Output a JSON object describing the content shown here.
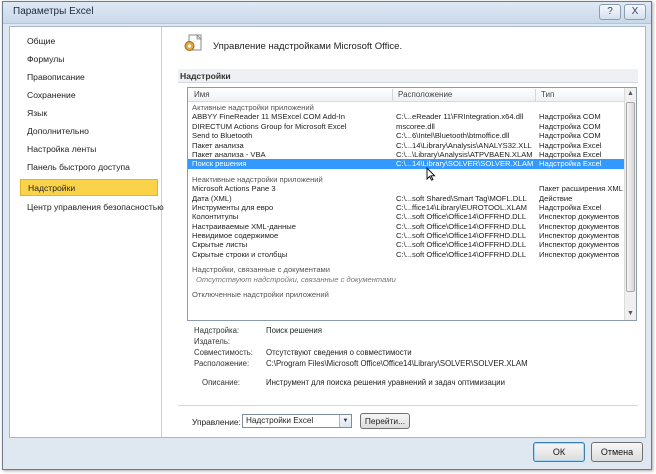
{
  "window": {
    "title": "Параметры Excel",
    "help_glyph": "?",
    "close_glyph": "X"
  },
  "nav": {
    "items": [
      {
        "label": "Общие"
      },
      {
        "label": "Формулы"
      },
      {
        "label": "Правописание"
      },
      {
        "label": "Сохранение"
      },
      {
        "label": "Язык"
      },
      {
        "label": "Дополнительно"
      },
      {
        "label": "Настройка ленты"
      },
      {
        "label": "Панель быстрого доступа"
      },
      {
        "label": "Надстройки",
        "selected": true
      },
      {
        "label": "Центр управления безопасностью"
      }
    ]
  },
  "header": {
    "title": "Управление надстройками Microsoft Office."
  },
  "section": {
    "label": "Надстройки"
  },
  "table": {
    "columns": [
      "Имя",
      "Расположение",
      "Тип"
    ],
    "groups": [
      {
        "label": "Активные надстройки приложений",
        "rows": [
          {
            "name": "ABBYY FineReader 11 MSExcel COM Add-In",
            "location": "C:\\...eReader 11\\FRIntegration.x64.dll",
            "type": "Надстройка COM"
          },
          {
            "name": "DIRECTUM Actions Group for Microsoft Excel",
            "location": "mscoree.dll",
            "type": "Надстройка COM"
          },
          {
            "name": "Send to Bluetooth",
            "location": "C:\\...6\\Intel\\Bluetooth\\btmoffice.dll",
            "type": "Надстройка COM"
          },
          {
            "name": "Пакет анализа",
            "location": "C:\\...14\\Library\\Analysis\\ANALYS32.XLL",
            "type": "Надстройка Excel"
          },
          {
            "name": "Пакет анализа - VBA",
            "location": "C:\\...\\Library\\Analysis\\ATPVBAEN.XLAM",
            "type": "Надстройка Excel"
          },
          {
            "name": "Поиск решения",
            "location": "C:\\...14\\Library\\SOLVER\\SOLVER.XLAM",
            "type": "Надстройка Excel",
            "selected": true
          }
        ]
      },
      {
        "label": "Неактивные надстройки приложений",
        "rows": [
          {
            "name": "Microsoft Actions Pane 3",
            "location": "",
            "type": "Пакет расширения XML"
          },
          {
            "name": "Дата (XML)",
            "location": "C:\\...soft Shared\\Smart Tag\\MOFL.DLL",
            "type": "Действие"
          },
          {
            "name": "Инструменты для евро",
            "location": "C:\\...ffice14\\Library\\EUROTOOL.XLAM",
            "type": "Надстройка Excel"
          },
          {
            "name": "Колонтитулы",
            "location": "C:\\...soft Office\\Office14\\OFFRHD.DLL",
            "type": "Инспектор документов"
          },
          {
            "name": "Настраиваемые XML-данные",
            "location": "C:\\...soft Office\\Office14\\OFFRHD.DLL",
            "type": "Инспектор документов"
          },
          {
            "name": "Невидимое содержимое",
            "location": "C:\\...soft Office\\Office14\\OFFRHD.DLL",
            "type": "Инспектор документов"
          },
          {
            "name": "Скрытые листы",
            "location": "C:\\...soft Office\\Office14\\OFFRHD.DLL",
            "type": "Инспектор документов"
          },
          {
            "name": "Скрытые строки и столбцы",
            "location": "C:\\...soft Office\\Office14\\OFFRHD.DLL",
            "type": "Инспектор документов"
          }
        ]
      },
      {
        "label": "Надстройки, связанные с документами",
        "note": "Отсутствуют надстройки, связанные с документами"
      },
      {
        "label": "Отключенные надстройки приложений"
      }
    ]
  },
  "details": {
    "addin_label": "Надстройка:",
    "addin_value": "Поиск решения",
    "publisher_label": "Издатель:",
    "publisher_value": "",
    "compat_label": "Совместимость:",
    "compat_value": "Отсутствуют сведения о совместимости",
    "location_label": "Расположение:",
    "location_value": "C:\\Program Files\\Microsoft Office\\Office14\\Library\\SOLVER\\SOLVER.XLAM",
    "desc_label": "Описание:",
    "desc_value": "Инструмент для поиска решения уравнений и задач оптимизации"
  },
  "manage": {
    "label": "Управление:",
    "selected": "Надстройки Excel",
    "go_label": "Перейти..."
  },
  "buttons": {
    "ok": "ОК",
    "cancel": "Отмена"
  },
  "colors": {
    "selected_nav": "#fbd34a",
    "selected_row": "#3399ff",
    "window_frame": "#dfe7f1"
  }
}
